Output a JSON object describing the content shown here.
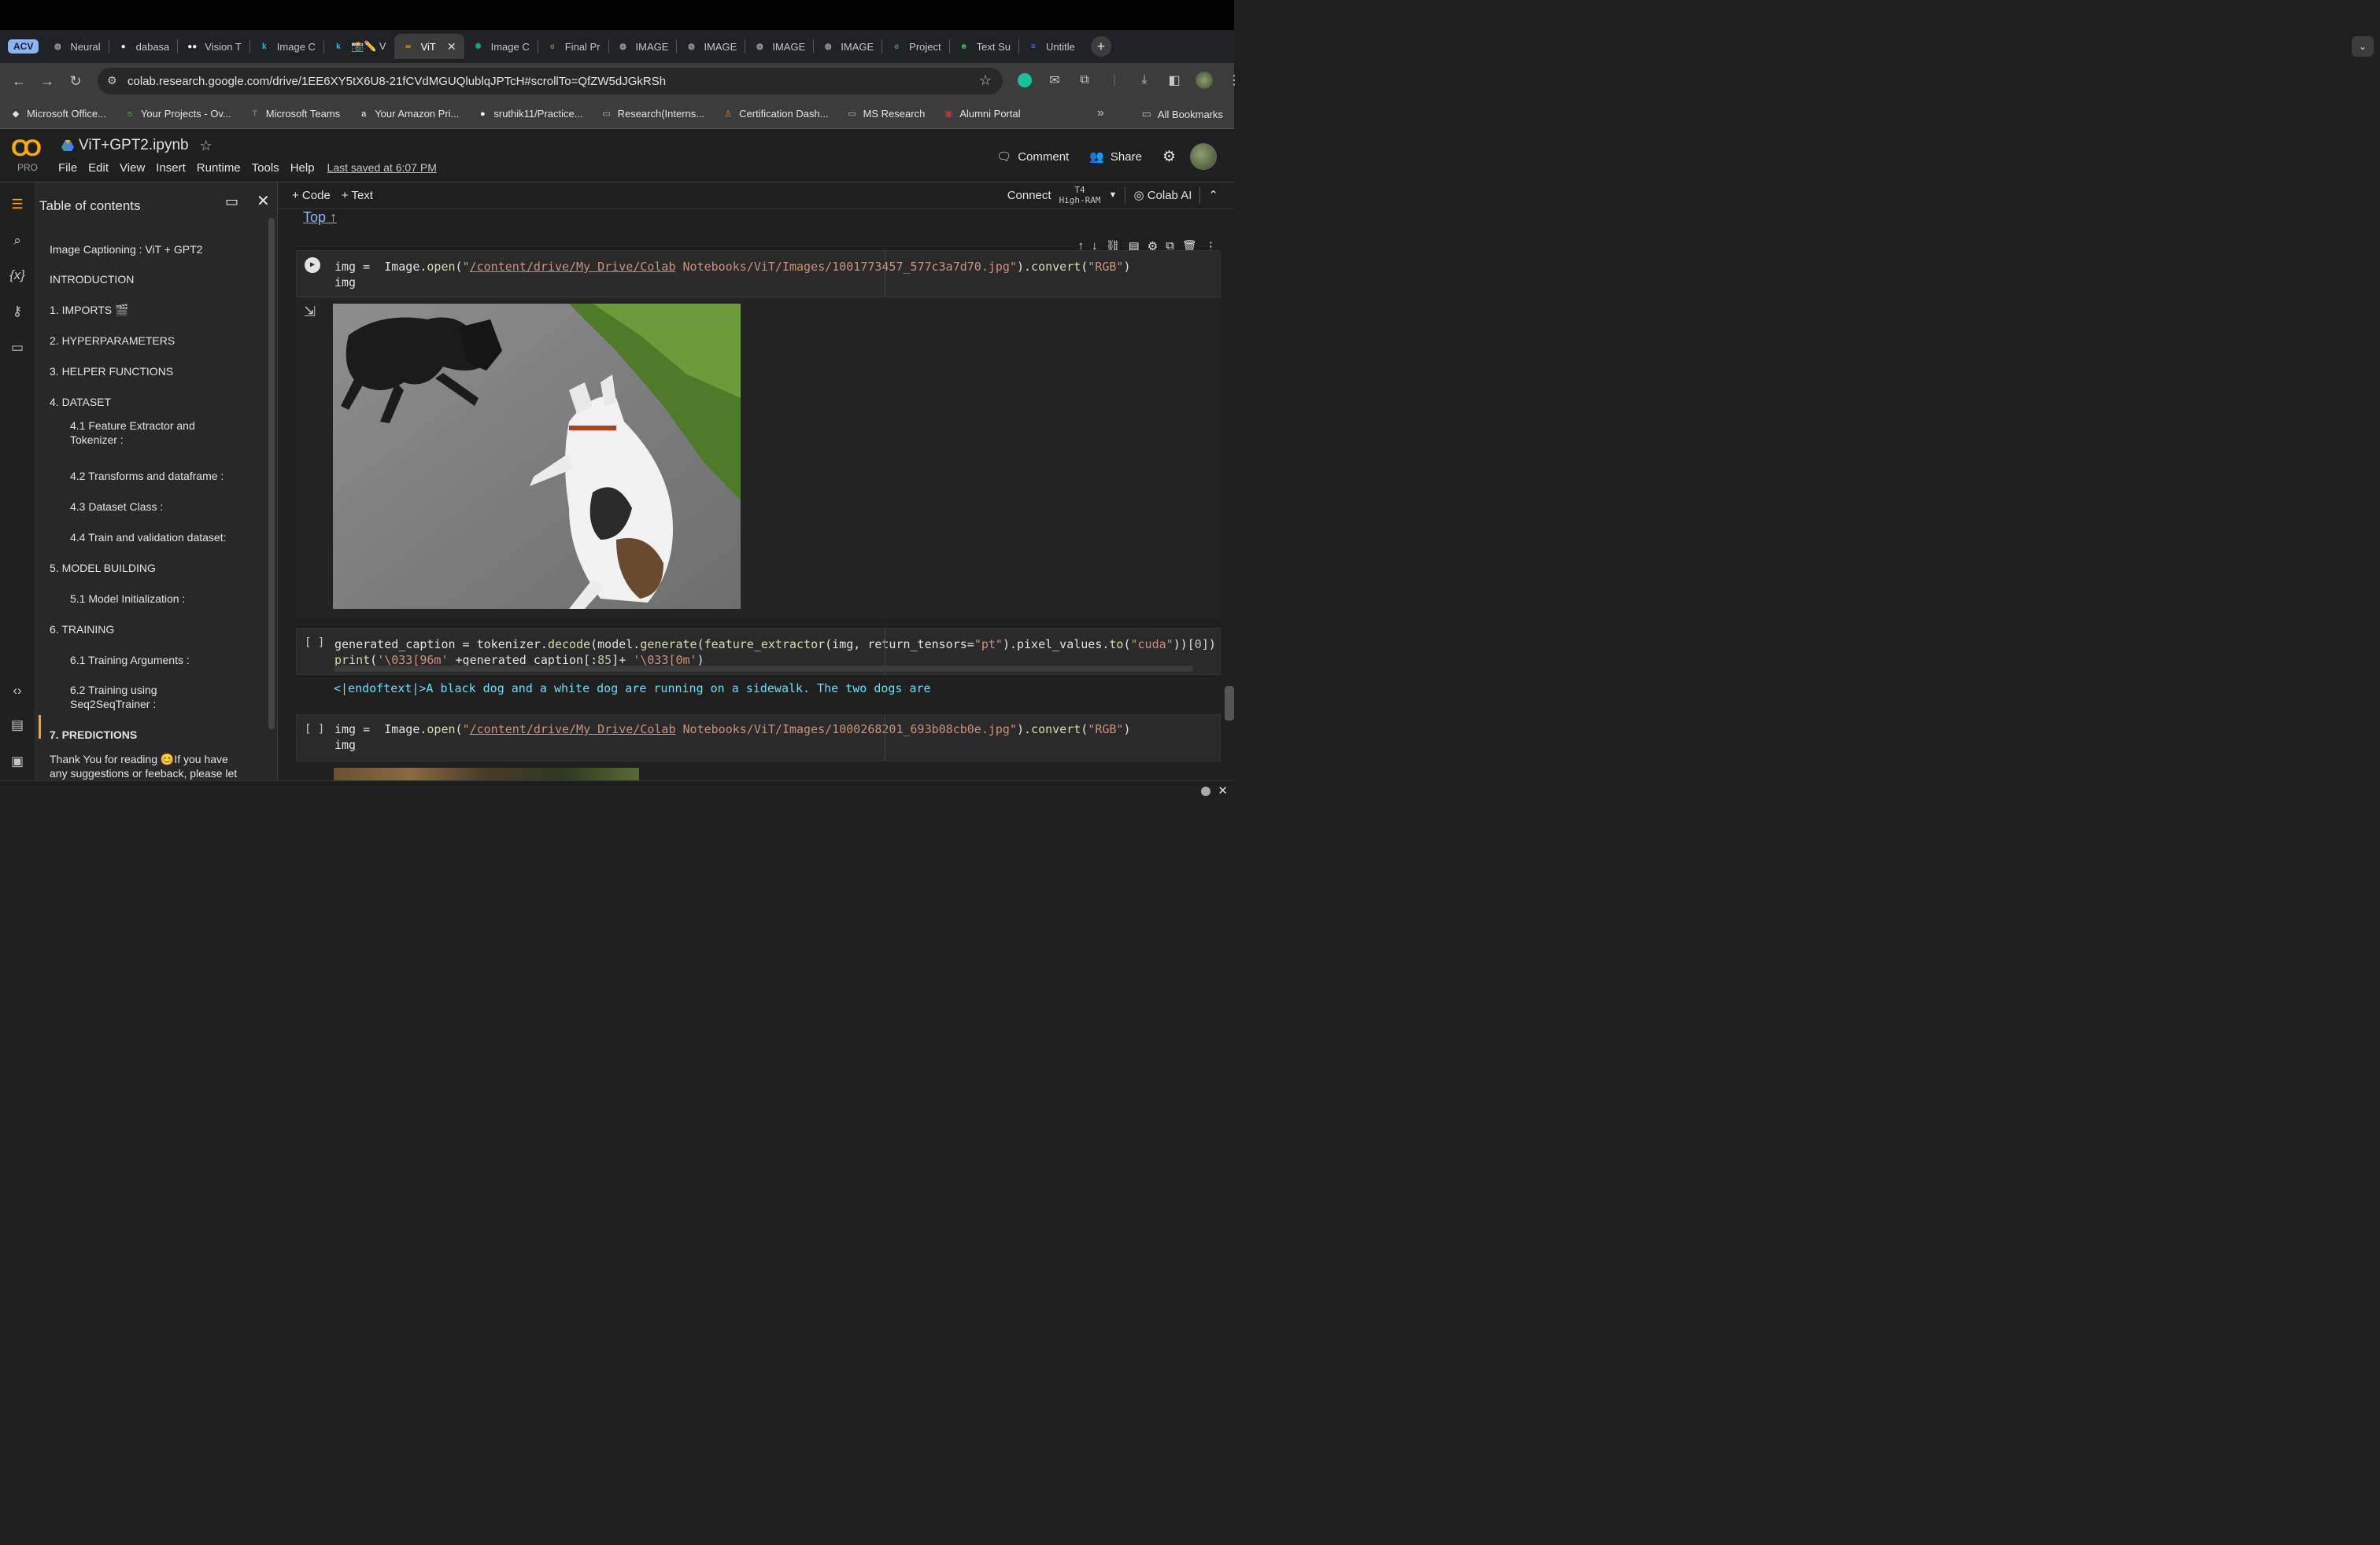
{
  "browser": {
    "tabs": [
      {
        "label": "ACV",
        "kind": "group"
      },
      {
        "label": "Neural",
        "icon": "globe-icon"
      },
      {
        "label": "dabasa",
        "icon": "github-icon"
      },
      {
        "label": "Vision T",
        "icon": "medium-icon"
      },
      {
        "label": "Image C",
        "icon": "kaggle-icon"
      },
      {
        "label": "📸✏️ V",
        "icon": "kaggle-icon"
      },
      {
        "label": "ViT",
        "icon": "colab-icon",
        "active": true
      },
      {
        "label": "Image C",
        "icon": "openai-icon"
      },
      {
        "label": "Final Pr",
        "icon": "overleaf-icon"
      },
      {
        "label": "IMAGE",
        "icon": "globe-icon"
      },
      {
        "label": "IMAGE",
        "icon": "globe-icon"
      },
      {
        "label": "IMAGE",
        "icon": "globe-icon"
      },
      {
        "label": "IMAGE",
        "icon": "globe-icon"
      },
      {
        "label": "Project",
        "icon": "overleaf-icon"
      },
      {
        "label": "Text Su",
        "icon": "ai-icon"
      },
      {
        "label": "Untitle",
        "icon": "docs-icon"
      }
    ],
    "url": "colab.research.google.com/drive/1EE6XY5tX6U8-21fCVdMGUQlublqJPTcH#scrollTo=QfZW5dJGkRSh",
    "bookmarks": [
      {
        "label": "Microsoft Office...",
        "icon": "office-icon"
      },
      {
        "label": "Your Projects - Ov...",
        "icon": "overleaf-icon"
      },
      {
        "label": "Microsoft Teams",
        "icon": "teams-icon"
      },
      {
        "label": "Your Amazon Pri...",
        "icon": "amazon-icon"
      },
      {
        "label": "sruthik11/Practice...",
        "icon": "github-icon"
      },
      {
        "label": "Research(Interns...",
        "icon": "folder-icon"
      },
      {
        "label": "Certification Dash...",
        "icon": "cert-icon"
      },
      {
        "label": "MS Research",
        "icon": "folder-icon"
      },
      {
        "label": "Alumni Portal",
        "icon": "alumni-icon"
      }
    ],
    "bookmarks_more": "»",
    "all_bookmarks": "All Bookmarks"
  },
  "colab": {
    "logo_text": "CO",
    "pro_label": "PRO",
    "notebook_title": "ViT+GPT2.ipynb",
    "menus": [
      "File",
      "Edit",
      "View",
      "Insert",
      "Runtime",
      "Tools",
      "Help"
    ],
    "last_saved": "Last saved at 6:07 PM",
    "comment_label": "Comment",
    "share_label": "Share"
  },
  "toolbar": {
    "add_code": "+ Code",
    "add_text": "+ Text",
    "connect": "Connect",
    "runtime_gpu": "T4",
    "runtime_ram": "High-RAM",
    "colab_ai": "Colab AI"
  },
  "toc": {
    "title": "Table of contents",
    "items": [
      {
        "label": "Image Captioning : ViT + GPT2",
        "level": 1
      },
      {
        "label": "INTRODUCTION",
        "level": 1
      },
      {
        "label": "1. IMPORTS 🎬",
        "level": 1
      },
      {
        "label": "2. HYPERPARAMETERS",
        "level": 1
      },
      {
        "label": "3. HELPER FUNCTIONS",
        "level": 1
      },
      {
        "label": "4. DATASET",
        "level": 1
      },
      {
        "label": "4.1 Feature Extractor and Tokenizer :",
        "level": 2
      },
      {
        "label": "4.2 Transforms and dataframe :",
        "level": 2
      },
      {
        "label": "4.3 Dataset Class :",
        "level": 2
      },
      {
        "label": "4.4 Train and validation dataset:",
        "level": 2
      },
      {
        "label": "5. MODEL BUILDING",
        "level": 1
      },
      {
        "label": "5.1 Model Initialization :",
        "level": 2
      },
      {
        "label": "6. TRAINING",
        "level": 1
      },
      {
        "label": "6.1 Training Arguments :",
        "level": 2
      },
      {
        "label": "6.2 Training using Seq2SeqTrainer :",
        "level": 2
      },
      {
        "label": "7. PREDICTIONS",
        "level": 1,
        "selected": true
      },
      {
        "label": "Thank You for reading 😊If you have any suggestions or feeback, please let",
        "level": 1
      }
    ]
  },
  "notebook": {
    "top_link": "Top ↑",
    "cell1": {
      "code_lines": [
        "img =  Image.open(\"/content/drive/My Drive/Colab Notebooks/ViT/Images/1001773457_577c3a7d70.jpg\").convert(\"RGB\")",
        "img"
      ]
    },
    "cell2": {
      "exec_label": "[ ]",
      "code_lines": [
        "generated_caption = tokenizer.decode(model.generate(feature_extractor(img, return_tensors=\"pt\").pixel_values.to(\"cuda\"))[0])",
        "print('\\033[96m' +generated_caption[:85]+ '\\033[0m')"
      ],
      "output": "<|endoftext|>A black dog and a white dog are running on a sidewalk. The two dogs are"
    },
    "cell3": {
      "exec_label": "[ ]",
      "code_lines": [
        "img =  Image.open(\"/content/drive/My Drive/Colab Notebooks/ViT/Images/1000268201_693b08cb0e.jpg\").convert(\"RGB\")",
        "img"
      ]
    }
  },
  "colors": {
    "accent": "#f9ab00",
    "link": "#8ab4f8",
    "output_text": "#5ee2ff"
  }
}
